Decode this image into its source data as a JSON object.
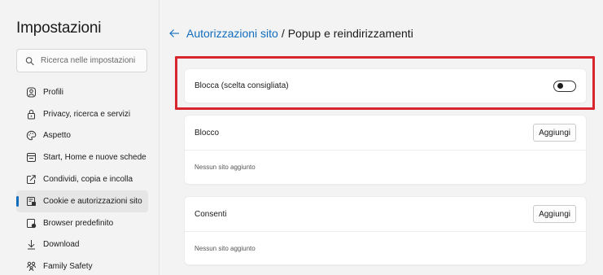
{
  "sidebar": {
    "title": "Impostazioni",
    "search_placeholder": "Ricerca nelle impostazioni",
    "items": [
      {
        "label": "Profili",
        "icon": "profile-icon"
      },
      {
        "label": "Privacy, ricerca e servizi",
        "icon": "lock-icon"
      },
      {
        "label": "Aspetto",
        "icon": "palette-icon"
      },
      {
        "label": "Start, Home e nuove schede",
        "icon": "start-home-icon"
      },
      {
        "label": "Condividi, copia e incolla",
        "icon": "share-icon"
      },
      {
        "label": "Cookie e autorizzazioni sito",
        "icon": "cookie-permissions-icon",
        "active": true
      },
      {
        "label": "Browser predefinito",
        "icon": "default-browser-icon"
      },
      {
        "label": "Download",
        "icon": "download-icon"
      },
      {
        "label": "Family Safety",
        "icon": "family-icon"
      }
    ]
  },
  "header": {
    "parent_link": "Autorizzazioni sito",
    "separator": "/",
    "current": "Popup e reindirizzamenti"
  },
  "block_setting": {
    "label": "Blocca (scelta consigliata)",
    "toggle_on": false
  },
  "block_list": {
    "title": "Blocco",
    "add_label": "Aggiungi",
    "empty_text": "Nessun sito aggiunto"
  },
  "allow_list": {
    "title": "Consenti",
    "add_label": "Aggiungi",
    "empty_text": "Nessun sito aggiunto"
  },
  "colors": {
    "accent": "#0f6cbd",
    "highlight": "#d7262e"
  }
}
